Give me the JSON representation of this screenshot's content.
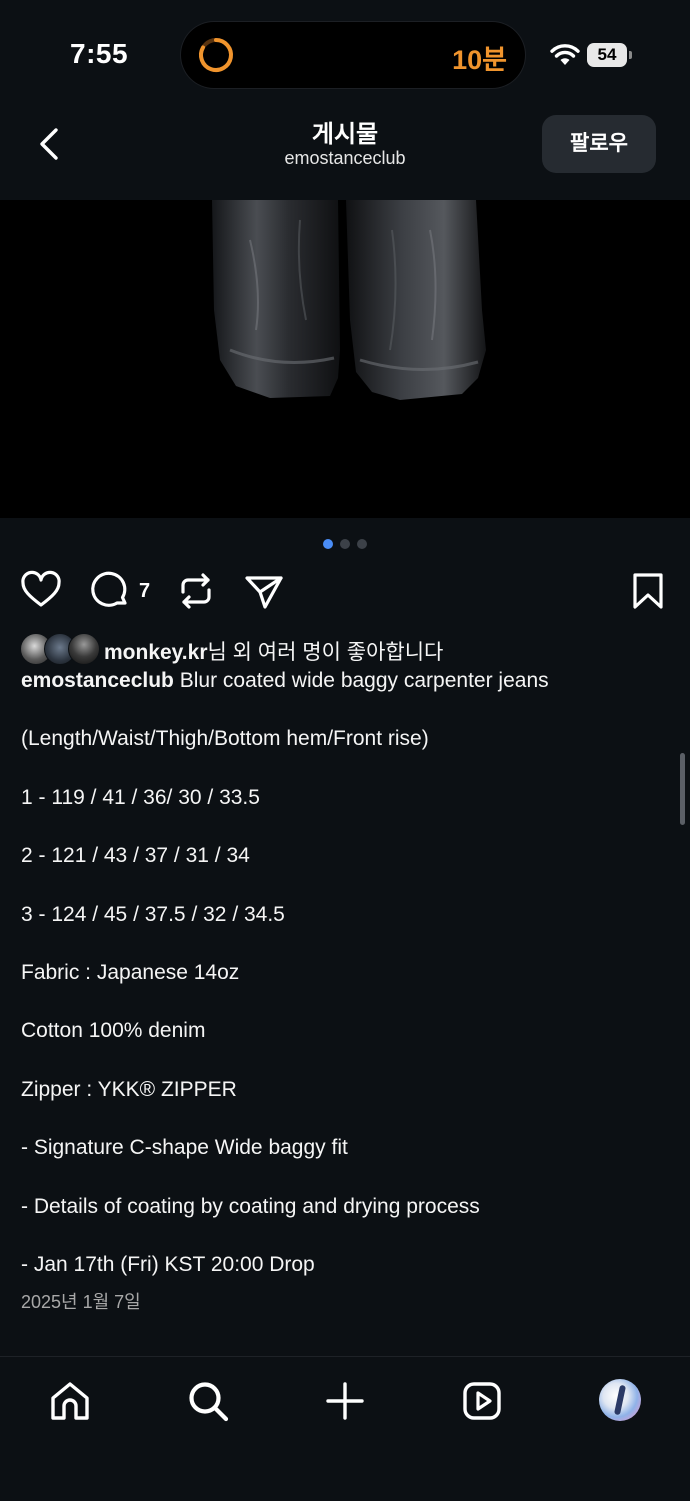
{
  "status_bar": {
    "time": "7:55",
    "timer": "10분",
    "battery": "54"
  },
  "header": {
    "title": "게시물",
    "subtitle": "emostanceclub",
    "follow_label": "팔로우"
  },
  "carousel": {
    "total": 3,
    "active": 1
  },
  "actions": {
    "comment_count": "7"
  },
  "likes": {
    "user": "monkey.kr",
    "suffix": "님 외 여러 명이 좋아합니다"
  },
  "caption": {
    "author": "emostanceclub",
    "lines": [
      "Blur coated wide baggy carpenter jeans",
      "(Length/Waist/Thigh/Bottom hem/Front rise)",
      "1 - 119 / 41 / 36/ 30 / 33.5",
      "2 - 121 / 43 / 37 / 31 / 34",
      "3 - 124 / 45 / 37.5 / 32 / 34.5",
      "Fabric : Japanese 14oz",
      "Cotton 100% denim",
      "Zipper : YKK® ZIPPER",
      "- Signature C-shape Wide baggy fit",
      "- Details of coating by coating and drying process",
      "- Jan 17th (Fri) KST 20:00 Drop"
    ]
  },
  "post_date": "2025년 1월 7일",
  "icons": {
    "back": "chevron-left-icon",
    "like": "heart-icon",
    "comment": "comment-bubble-icon",
    "repost": "repost-icon",
    "share": "send-icon",
    "save": "bookmark-icon",
    "nav": [
      "home-icon",
      "search-icon",
      "plus-icon",
      "reels-icon",
      "profile-avatar"
    ]
  },
  "colors": {
    "background": "#0c1014",
    "accent_dot": "#4a8df6",
    "timer": "#f0942d"
  }
}
